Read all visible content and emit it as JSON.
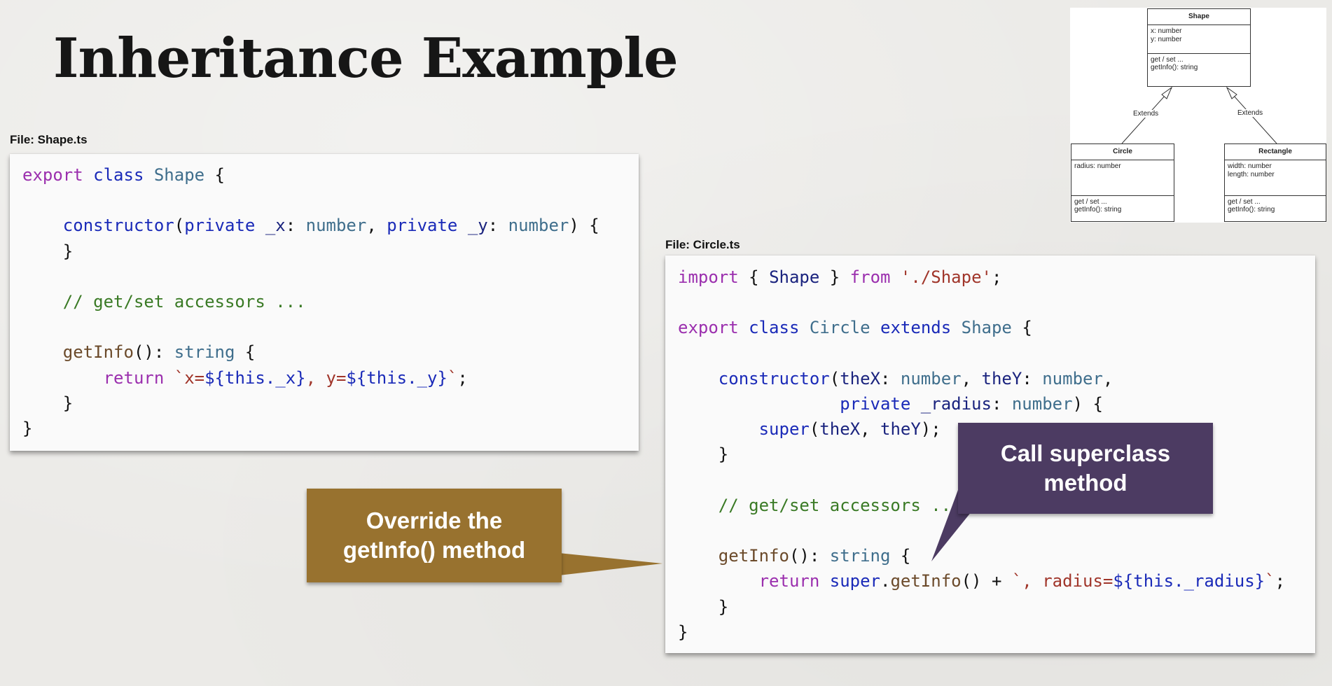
{
  "slide": {
    "title": "Inheritance Example"
  },
  "shape_file": {
    "label": "File: Shape.ts",
    "lines": [
      "export class Shape {",
      "",
      "    constructor(private _x: number, private _y: number) {",
      "    }",
      "",
      "    // get/set accessors ...",
      "",
      "    getInfo(): string {",
      "        return `x=${this._x}, y=${this._y}`;",
      "    }",
      "}"
    ]
  },
  "circle_file": {
    "label": "File: Circle.ts",
    "lines": [
      "import { Shape } from './Shape';",
      "",
      "export class Circle extends Shape {",
      "",
      "    constructor(theX: number, theY: number,",
      "                private _radius: number) {",
      "        super(theX, theY);",
      "    }",
      "",
      "    // get/set accessors ...",
      "",
      "    getInfo(): string {",
      "        return super.getInfo() + `, radius=${this._radius}`;",
      "    }",
      "}"
    ]
  },
  "callouts": {
    "override": "Override the getInfo() method",
    "super": "Call superclass method"
  },
  "uml": {
    "classes": {
      "shape": {
        "name": "Shape",
        "attributes": [
          "x: number",
          "y: number"
        ],
        "operations": [
          "get / set ...",
          "getInfo(): string"
        ]
      },
      "circle": {
        "name": "Circle",
        "attributes": [
          "radius: number"
        ],
        "operations": [
          "get / set ...",
          "getInfo(): string"
        ]
      },
      "rectangle": {
        "name": "Rectangle",
        "attributes": [
          "width: number",
          "length: number"
        ],
        "operations": [
          "get / set ...",
          "getInfo(): string"
        ]
      }
    },
    "relations": [
      {
        "from": "Circle",
        "to": "Shape",
        "label": "Extends"
      },
      {
        "from": "Rectangle",
        "to": "Shape",
        "label": "Extends"
      }
    ]
  },
  "colors": {
    "keyword": "#9b2fae",
    "declaration_keyword": "#1a2ab8",
    "type": "#3f6e8c",
    "comment": "#3a7a25",
    "string": "#a0352a",
    "method": "#6b4a2a",
    "override_callout": "#98722f",
    "super_callout": "#4c3b62"
  }
}
